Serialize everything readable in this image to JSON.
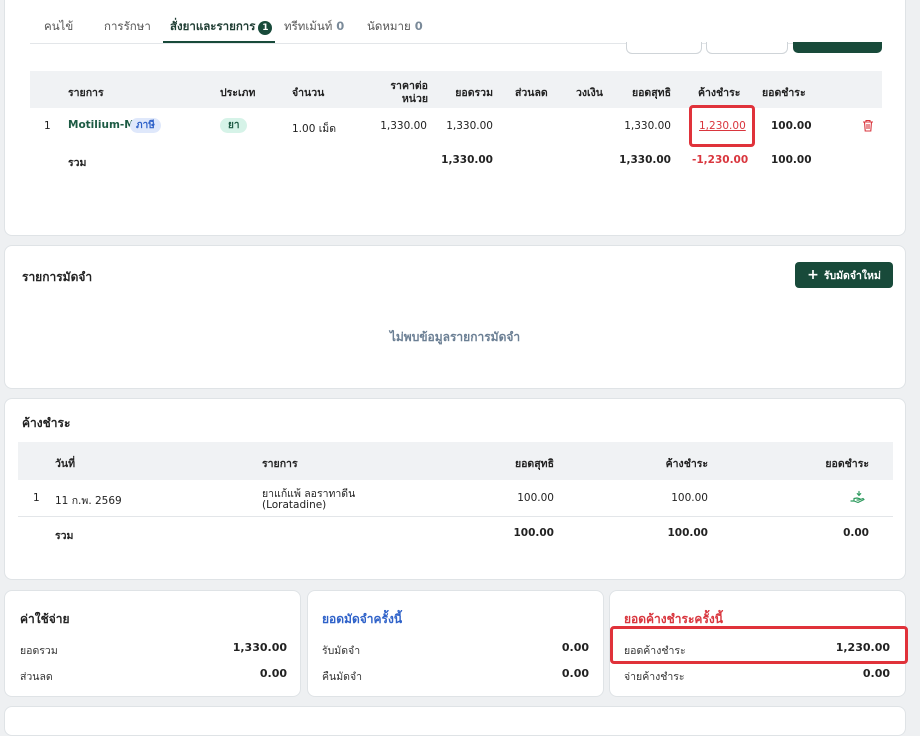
{
  "tabs": [
    {
      "label": "คนไข้"
    },
    {
      "label": "การรักษา"
    },
    {
      "label": "สั่งยาและรายการ",
      "badge": "1"
    },
    {
      "label": "ทรีทเม้นท์",
      "count": "0"
    },
    {
      "label": "นัดหมาย",
      "count": "0"
    }
  ],
  "order_table": {
    "headers": {
      "item": "รายการ",
      "type": "ประเภท",
      "qty": "จำนวน",
      "unit_price_1": "ราคาต่อ",
      "unit_price_2": "หน่วย",
      "total": "ยอดรวม",
      "discount": "ส่วนลด",
      "limit": "วงเงิน",
      "net": "ยอดสุทธิ",
      "outstanding": "ค้างชำระ",
      "paid": "ยอดชำระ"
    },
    "row": {
      "no": "1",
      "name": "Motilium-M",
      "tag": "ภาษี",
      "type": "ยา",
      "qty": "1.00 เม็ด",
      "unit_price": "1,330.00",
      "total": "1,330.00",
      "net": "1,330.00",
      "outstanding": "1,230.00",
      "paid": "100.00"
    },
    "sum": {
      "label": "รวม",
      "total": "1,330.00",
      "net": "1,330.00",
      "outstanding": "-1,230.00",
      "paid": "100.00"
    }
  },
  "deposit_section": {
    "title": "รายการมัดจำ",
    "button_label": "รับมัดจำใหม่",
    "empty_text": "ไม่พบข้อมูลรายการมัดจำ"
  },
  "arrears_section": {
    "title": "ค้างชำระ",
    "headers": {
      "date": "วันที่",
      "item": "รายการ",
      "net": "ยอดสุทธิ",
      "outstanding": "ค้างชำระ",
      "paid": "ยอดชำระ"
    },
    "row": {
      "no": "1",
      "date": "11 ก.พ. 2569",
      "item_line1": "ยาแก้แพ้ ลอราทาดีน",
      "item_line2": "(Loratadine)",
      "net": "100.00",
      "outstanding": "100.00"
    },
    "sum": {
      "label": "รวม",
      "net": "100.00",
      "outstanding": "100.00",
      "paid": "0.00"
    }
  },
  "expense_card": {
    "title": "ค่าใช้จ่าย",
    "total_label": "ยอดรวม",
    "total_value": "1,330.00",
    "discount_label": "ส่วนลด",
    "discount_value": "0.00"
  },
  "deposit_card": {
    "title": "ยอดมัดจำครั้งนี้",
    "receive_label": "รับมัดจำ",
    "receive_value": "0.00",
    "refund_label": "คืนมัดจำ",
    "refund_value": "0.00"
  },
  "outstanding_card": {
    "title": "ยอดค้างชำระครั้งนี้",
    "outstanding_label": "ยอดค้างชำระ",
    "outstanding_value": "1,230.00",
    "pay_label": "จ่ายค้างชำระ",
    "pay_value": "0.00"
  },
  "colors": {
    "brand": "#184a3a",
    "accent_green": "#1d5b44",
    "danger": "#d9363e",
    "link_blue": "#2f62c9"
  }
}
